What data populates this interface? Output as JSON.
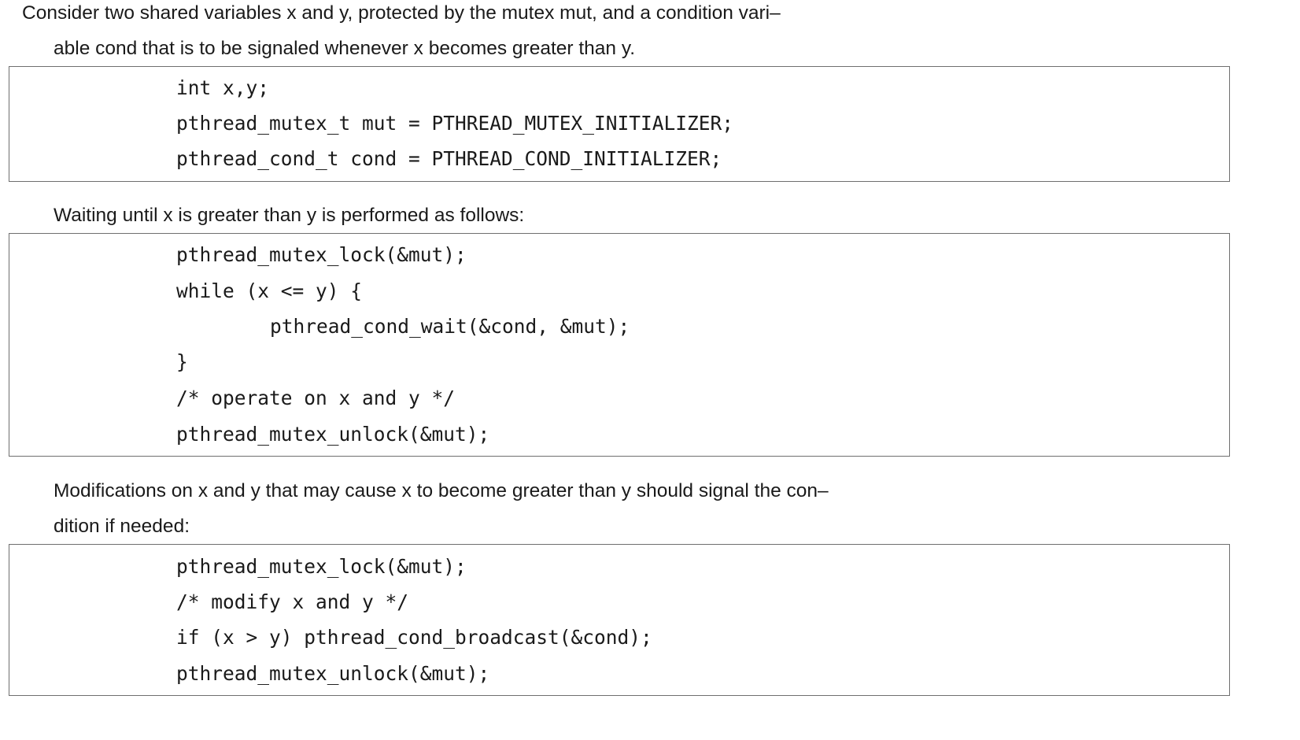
{
  "intro": {
    "line1": "Consider two shared variables x and y, protected by the mutex mut, and a condition vari–",
    "line2": "able cond that is to be signaled whenever x becomes greater than y."
  },
  "code_declarations": {
    "lines": [
      "int x,y;",
      "pthread_mutex_t mut = PTHREAD_MUTEX_INITIALIZER;",
      "pthread_cond_t cond = PTHREAD_COND_INITIALIZER;"
    ]
  },
  "waiting_text": "Waiting until x is greater than y is performed as follows:",
  "code_wait": {
    "lines": [
      "pthread_mutex_lock(&mut);",
      "while (x <= y) {",
      "pthread_cond_wait(&cond, &mut);",
      "}",
      "/* operate on x and y */",
      "pthread_mutex_unlock(&mut);"
    ]
  },
  "modifications": {
    "line1": "Modifications on x and y that may cause x to become greater than y should signal the con–",
    "line2": "dition if needed:"
  },
  "code_signal": {
    "lines": [
      "pthread_mutex_lock(&mut);",
      "/* modify x and y */",
      "if (x > y) pthread_cond_broadcast(&cond);",
      "pthread_mutex_unlock(&mut);"
    ]
  }
}
